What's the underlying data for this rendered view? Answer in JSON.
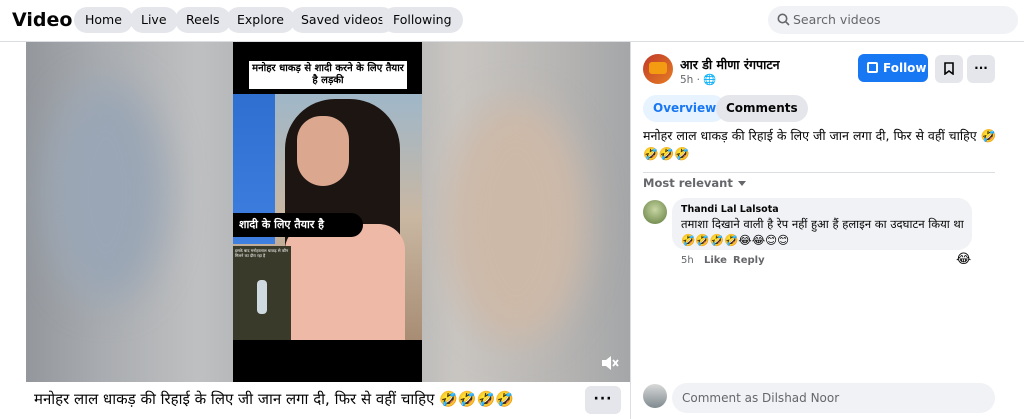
{
  "header": {
    "title": "Video",
    "nav": [
      "Home",
      "Live",
      "Reels",
      "Explore",
      "Saved videos",
      "Following"
    ],
    "search_placeholder": "Search videos"
  },
  "video": {
    "caption_top": "मनोहर धाकड़ से शादी करने के लिए तैयार है लड़की",
    "caption_mid": "शादी के लिए तैयार है",
    "inset_text": "इसके बाद मनोहरलाल धाकड़ से कौन मिलने का दौरा रहा है",
    "mute_icon": "speaker-muted-icon"
  },
  "post": {
    "title": "मनोहर लाल धाकड़ की रिहाई के लिए जी जान लगा दी, फिर से वहीं चाहिए 🤣🤣🤣🤣",
    "more_label": "···"
  },
  "panel": {
    "page_name": "आर डी मीणा रंगपाटन",
    "time": "5h · 🌐",
    "follow_label": "Follow",
    "more_label": "···",
    "tabs": [
      "Overview",
      "Comments"
    ],
    "text": "मनोहर लाल धाकड़ की रिहाई के लिए जी जान लगा दी, फिर से वहीं चाहिए 🤣🤣🤣🤣",
    "sort_label": "Most relevant",
    "comment": {
      "author": "Thandi Lal Lalsota",
      "text": "तमाशा दिखाने वाली है रेप नहीं हुआ हैं हलाइन का उदघाटन किया था 🤣🤣🤣🤣😂😂😊😊",
      "time": "5h",
      "like": "Like",
      "reply": "Reply",
      "reaction": "😂"
    },
    "comment_placeholder": "Comment as Dilshad Noor"
  },
  "colors": {
    "accent": "#1877f2",
    "tab_active_bg": "#e7f3ff",
    "button_bg": "#e4e6eb"
  }
}
